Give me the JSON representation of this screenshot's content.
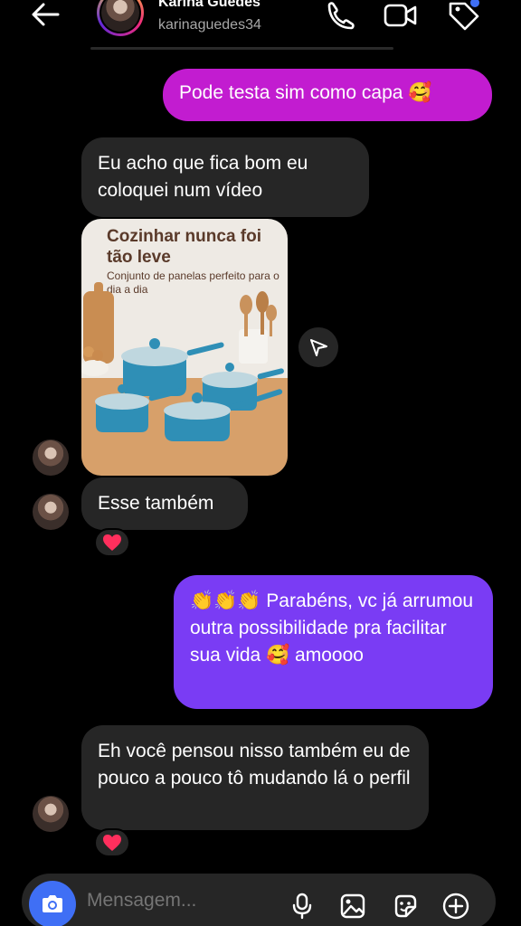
{
  "header": {
    "name": "Karina Guedes",
    "username": "karinaguedes34"
  },
  "messages": [
    {
      "text": "Pode testa sim como capa 🥰"
    },
    {
      "text": "Eu acho que fica bom eu coloquei num vídeo"
    },
    {
      "media": {
        "title": "Cozinhar nunca foi tão leve",
        "subtitle": "Conjunto de panelas perfeito para o dia a dia"
      }
    },
    {
      "text": "Esse também",
      "reaction": "❤️"
    },
    {
      "text": "👏👏👏 Parabéns, vc já arrumou outra possibilidade pra facilitar sua vida 🥰 amoooo"
    },
    {
      "text": "Eh você pensou nisso também eu de pouco a pouco tô mudando lá o perfil",
      "reaction": "❤️"
    }
  ],
  "composer": {
    "placeholder": "Mensagem..."
  },
  "colors": {
    "outgoing_pink": "#c21cd0",
    "outgoing_purple": "#7a3cf4",
    "incoming": "#262626",
    "camera_blue": "#3f6ff5"
  }
}
